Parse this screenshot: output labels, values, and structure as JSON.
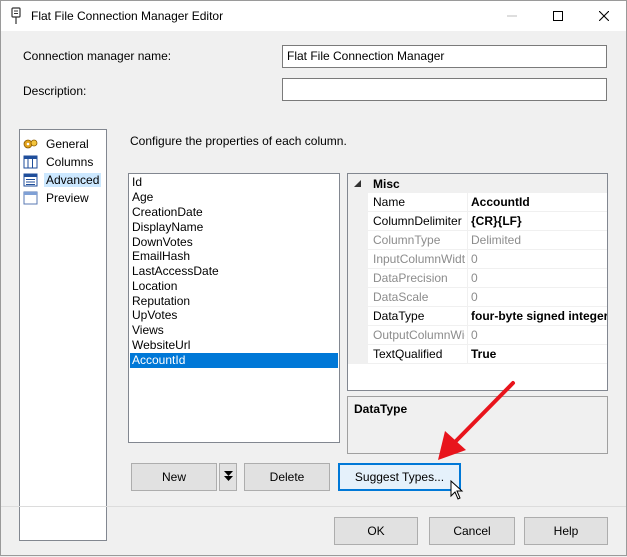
{
  "window": {
    "title": "Flat File Connection Manager Editor",
    "controls": {
      "minimize": "minimize",
      "maximize": "maximize",
      "close": "close"
    }
  },
  "form": {
    "name_label": "Connection manager name:",
    "name_value": "Flat File Connection Manager",
    "description_label": "Description:",
    "description_value": ""
  },
  "nav": {
    "items": [
      {
        "label": "General",
        "icon": "general-icon",
        "selected": false
      },
      {
        "label": "Columns",
        "icon": "columns-icon",
        "selected": false
      },
      {
        "label": "Advanced",
        "icon": "advanced-icon",
        "selected": true
      },
      {
        "label": "Preview",
        "icon": "preview-icon",
        "selected": false
      }
    ]
  },
  "main": {
    "instruction": "Configure the properties of each column.",
    "columns": [
      "Id",
      "Age",
      "CreationDate",
      "DisplayName",
      "DownVotes",
      "EmailHash",
      "LastAccessDate",
      "Location",
      "Reputation",
      "UpVotes",
      "Views",
      "WebsiteUrl",
      "AccountId"
    ],
    "selected_column": "AccountId"
  },
  "properties": {
    "category": "Misc",
    "rows": [
      {
        "name": "Name",
        "value": "AccountId",
        "state": "bold"
      },
      {
        "name": "ColumnDelimiter",
        "value": "{CR}{LF}",
        "state": "bold"
      },
      {
        "name": "ColumnType",
        "value": "Delimited",
        "state": "disabled"
      },
      {
        "name": "InputColumnWidth",
        "value": "0",
        "state": "disabled"
      },
      {
        "name": "DataPrecision",
        "value": "0",
        "state": "disabled"
      },
      {
        "name": "DataScale",
        "value": "0",
        "state": "disabled"
      },
      {
        "name": "DataType",
        "value": "four-byte signed integer",
        "state": "bold"
      },
      {
        "name": "OutputColumnWidth",
        "value": "0",
        "state": "disabled"
      },
      {
        "name": "TextQualified",
        "value": "True",
        "state": "bold"
      }
    ],
    "description_title": "DataType"
  },
  "buttons": {
    "new": "New",
    "delete": "Delete",
    "suggest_types": "Suggest Types...",
    "ok": "OK",
    "cancel": "Cancel",
    "help": "Help"
  },
  "colors": {
    "selection": "#0078d7",
    "nav_selection": "#cce8ff",
    "annotation_arrow": "#e8141c"
  }
}
